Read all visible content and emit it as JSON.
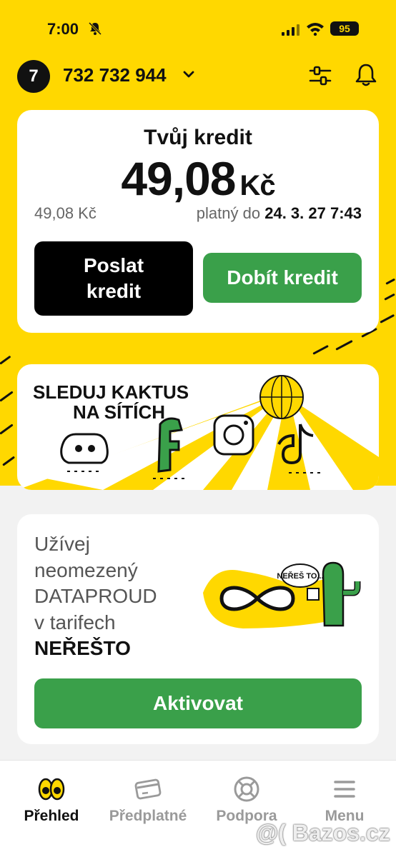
{
  "status_bar": {
    "time": "7:00",
    "battery": "95"
  },
  "header": {
    "brand": "7",
    "phone_number": "732 732 944"
  },
  "credit": {
    "title": "Tvůj kredit",
    "amount": "49,08",
    "currency": "Kč",
    "small_amount": "49,08 Kč",
    "valid_label": "platný do",
    "valid_until": "24. 3. 27 7:43",
    "send_button": "Poslat kredit",
    "topup_button": "Dobít kredit"
  },
  "social_banner": {
    "line1": "SLEDUJ KAKTUS",
    "line2": "NA SÍTÍCH"
  },
  "promo": {
    "line1": "Užívej",
    "line2": "neomezený",
    "line3": "DATAPROUD",
    "line4": "v tarifech",
    "line5": "NEŘEŠTO",
    "bubble": "NEŘEŠ TO...",
    "button": "Aktivovat"
  },
  "tabs": [
    {
      "label": "Přehled",
      "active": true
    },
    {
      "label": "Předplatné",
      "active": false
    },
    {
      "label": "Podpora",
      "active": false
    },
    {
      "label": "Menu",
      "active": false
    }
  ],
  "watermark": "@( Bazos.cz",
  "colors": {
    "brand_yellow": "#ffd800",
    "action_green": "#3aa04a",
    "black": "#000000"
  }
}
